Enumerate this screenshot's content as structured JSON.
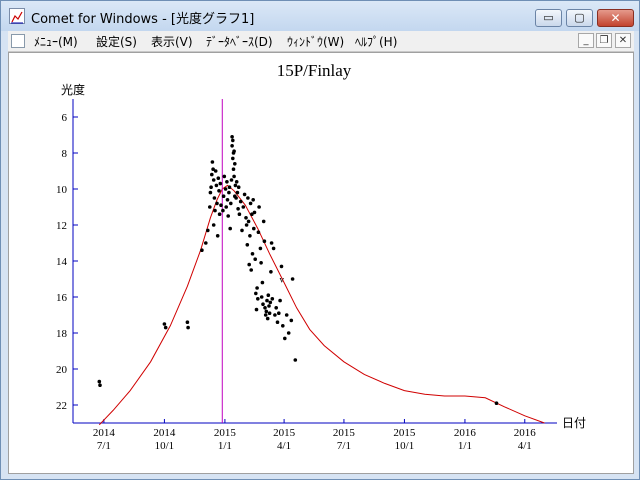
{
  "window": {
    "title": "Comet for Windows - [光度グラフ1]",
    "controls": {
      "minimize": "▭",
      "maximize": "▢",
      "close": "✕"
    }
  },
  "menu": {
    "items": [
      "ﾒﾆｭｰ(M)",
      "設定(S)",
      "表示(V)",
      "ﾃﾞｰﾀﾍﾞｰｽ(D)",
      "ｳｨﾝﾄﾞｳ(W)",
      "ﾍﾙﾌﾟ(H)"
    ],
    "mdi_controls": {
      "minimize": "_",
      "restore": "❐",
      "close": "✕"
    }
  },
  "chart_data": {
    "type": "scatter",
    "title": "15P/Finlay",
    "ylabel": "光度",
    "xlabel": "日付",
    "ylim": [
      5,
      23
    ],
    "y_inverted": true,
    "y_ticks": [
      6,
      8,
      10,
      12,
      14,
      16,
      18,
      20,
      22
    ],
    "xlim": [
      "2014-05-15",
      "2016-05-20"
    ],
    "x_ticks": [
      {
        "date": "2014-07-01",
        "year": "2014",
        "label": "7/1"
      },
      {
        "date": "2014-10-01",
        "year": "2014",
        "label": "10/1"
      },
      {
        "date": "2015-01-01",
        "year": "2015",
        "label": "1/1"
      },
      {
        "date": "2015-04-01",
        "year": "2015",
        "label": "4/1"
      },
      {
        "date": "2015-07-01",
        "year": "2015",
        "label": "7/1"
      },
      {
        "date": "2015-10-01",
        "year": "2015",
        "label": "10/1"
      },
      {
        "date": "2016-01-01",
        "year": "2016",
        "label": "1/1"
      },
      {
        "date": "2016-04-01",
        "year": "2016",
        "label": "4/1"
      }
    ],
    "marker_date": "2014-12-28",
    "annotation": {
      "date": "2015-03-25",
      "mag": 15.2,
      "text": "v"
    },
    "colors": {
      "axis": "#0000c0",
      "curve": "#d00000",
      "points": "#000000",
      "marker": "#c000c0"
    },
    "series": [
      {
        "points": [
          [
            "2014-06-24",
            20.7
          ],
          [
            "2014-06-25",
            20.9
          ],
          [
            "2014-10-01",
            17.5
          ],
          [
            "2014-10-03",
            17.7
          ],
          [
            "2014-11-05",
            17.4
          ],
          [
            "2014-11-06",
            17.7
          ],
          [
            "2014-11-27",
            13.4
          ],
          [
            "2014-12-03",
            13.0
          ],
          [
            "2014-12-06",
            12.3
          ],
          [
            "2014-12-09",
            11.0
          ],
          [
            "2014-12-10",
            10.2
          ],
          [
            "2014-12-11",
            9.9
          ],
          [
            "2014-12-12",
            9.2
          ],
          [
            "2014-12-13",
            8.5
          ],
          [
            "2014-12-14",
            8.9
          ],
          [
            "2014-12-15",
            9.5
          ],
          [
            "2014-12-15",
            12.0
          ],
          [
            "2014-12-16",
            10.5
          ],
          [
            "2014-12-17",
            11.2
          ],
          [
            "2014-12-18",
            9.0
          ],
          [
            "2014-12-19",
            9.8
          ],
          [
            "2014-12-20",
            10.8
          ],
          [
            "2014-12-21",
            12.6
          ],
          [
            "2014-12-22",
            9.4
          ],
          [
            "2014-12-23",
            10.1
          ],
          [
            "2014-12-24",
            11.4
          ],
          [
            "2014-12-25",
            9.7
          ],
          [
            "2014-12-26",
            10.9
          ],
          [
            "2014-12-29",
            11.2
          ],
          [
            "2014-12-30",
            10.4
          ],
          [
            "2014-12-31",
            9.3
          ],
          [
            "2015-01-02",
            10.0
          ],
          [
            "2015-01-03",
            11.0
          ],
          [
            "2015-01-04",
            9.6
          ],
          [
            "2015-01-05",
            10.6
          ],
          [
            "2015-01-06",
            11.5
          ],
          [
            "2015-01-07",
            10.2
          ],
          [
            "2015-01-08",
            9.9
          ],
          [
            "2015-01-09",
            12.2
          ],
          [
            "2015-01-10",
            10.8
          ],
          [
            "2015-01-11",
            9.5
          ],
          [
            "2015-01-12",
            7.1
          ],
          [
            "2015-01-12",
            7.6
          ],
          [
            "2015-01-13",
            7.3
          ],
          [
            "2015-01-13",
            8.3
          ],
          [
            "2015-01-14",
            8.0
          ],
          [
            "2015-01-14",
            8.9
          ],
          [
            "2015-01-15",
            7.9
          ],
          [
            "2015-01-15",
            9.3
          ],
          [
            "2015-01-16",
            8.6
          ],
          [
            "2015-01-16",
            10.4
          ],
          [
            "2015-01-17",
            9.8
          ],
          [
            "2015-01-18",
            10.5
          ],
          [
            "2015-01-19",
            9.6
          ],
          [
            "2015-01-20",
            10.2
          ],
          [
            "2015-01-21",
            11.1
          ],
          [
            "2015-01-22",
            9.9
          ],
          [
            "2015-01-23",
            11.4
          ],
          [
            "2015-01-25",
            10.7
          ],
          [
            "2015-01-27",
            12.3
          ],
          [
            "2015-01-29",
            11.0
          ],
          [
            "2015-01-31",
            10.3
          ],
          [
            "2015-02-02",
            11.6
          ],
          [
            "2015-02-03",
            12.0
          ],
          [
            "2015-02-04",
            13.1
          ],
          [
            "2015-02-05",
            10.5
          ],
          [
            "2015-02-06",
            11.8
          ],
          [
            "2015-02-07",
            14.2
          ],
          [
            "2015-02-08",
            12.6
          ],
          [
            "2015-02-09",
            10.8
          ],
          [
            "2015-02-10",
            14.5
          ],
          [
            "2015-02-11",
            11.4
          ],
          [
            "2015-02-12",
            13.6
          ],
          [
            "2015-02-13",
            10.6
          ],
          [
            "2015-02-14",
            12.2
          ],
          [
            "2015-02-15",
            11.3
          ],
          [
            "2015-02-16",
            13.9
          ],
          [
            "2015-02-17",
            15.8
          ],
          [
            "2015-02-18",
            16.7
          ],
          [
            "2015-02-19",
            15.5
          ],
          [
            "2015-02-20",
            16.1
          ],
          [
            "2015-02-21",
            12.4
          ],
          [
            "2015-02-22",
            11.0
          ],
          [
            "2015-02-24",
            13.3
          ],
          [
            "2015-02-25",
            14.1
          ],
          [
            "2015-02-26",
            16.0
          ],
          [
            "2015-02-27",
            15.2
          ],
          [
            "2015-02-28",
            16.4
          ],
          [
            "2015-03-01",
            11.8
          ],
          [
            "2015-03-02",
            12.9
          ],
          [
            "2015-03-03",
            16.6
          ],
          [
            "2015-03-04",
            17.0
          ],
          [
            "2015-03-05",
            16.8
          ],
          [
            "2015-03-06",
            16.2
          ],
          [
            "2015-03-07",
            17.2
          ],
          [
            "2015-03-08",
            15.9
          ],
          [
            "2015-03-09",
            16.5
          ],
          [
            "2015-03-10",
            16.9
          ],
          [
            "2015-03-11",
            16.3
          ],
          [
            "2015-03-12",
            14.6
          ],
          [
            "2015-03-13",
            13.0
          ],
          [
            "2015-03-14",
            16.1
          ],
          [
            "2015-03-16",
            13.3
          ],
          [
            "2015-03-18",
            17.0
          ],
          [
            "2015-03-20",
            16.6
          ],
          [
            "2015-03-22",
            17.4
          ],
          [
            "2015-03-24",
            16.9
          ],
          [
            "2015-03-26",
            16.2
          ],
          [
            "2015-03-28",
            14.3
          ],
          [
            "2015-03-30",
            17.6
          ],
          [
            "2015-04-02",
            18.3
          ],
          [
            "2015-04-05",
            17.0
          ],
          [
            "2015-04-08",
            18.0
          ],
          [
            "2015-04-12",
            17.3
          ],
          [
            "2015-04-14",
            15.0
          ],
          [
            "2015-04-18",
            19.5
          ],
          [
            "2016-02-18",
            21.9
          ]
        ]
      },
      {
        "curve": [
          [
            "2014-06-24",
            23.1
          ],
          [
            "2014-07-15",
            22.3
          ],
          [
            "2014-08-10",
            21.2
          ],
          [
            "2014-09-10",
            19.6
          ],
          [
            "2014-10-10",
            17.6
          ],
          [
            "2014-11-05",
            15.4
          ],
          [
            "2014-11-25",
            13.4
          ],
          [
            "2014-12-10",
            11.6
          ],
          [
            "2014-12-20",
            10.6
          ],
          [
            "2014-12-28",
            10.0
          ],
          [
            "2015-01-05",
            9.8
          ],
          [
            "2015-01-15",
            10.1
          ],
          [
            "2015-02-01",
            10.9
          ],
          [
            "2015-02-20",
            12.2
          ],
          [
            "2015-03-10",
            13.6
          ],
          [
            "2015-04-01",
            15.2
          ],
          [
            "2015-04-20",
            16.6
          ],
          [
            "2015-05-10",
            17.8
          ],
          [
            "2015-06-01",
            18.7
          ],
          [
            "2015-07-01",
            19.6
          ],
          [
            "2015-08-01",
            20.3
          ],
          [
            "2015-09-01",
            20.8
          ],
          [
            "2015-10-01",
            21.2
          ],
          [
            "2015-11-01",
            21.4
          ],
          [
            "2015-12-01",
            21.5
          ],
          [
            "2016-01-01",
            21.5
          ],
          [
            "2016-02-01",
            21.6
          ],
          [
            "2016-03-01",
            22.1
          ],
          [
            "2016-04-01",
            22.6
          ],
          [
            "2016-05-01",
            23.0
          ]
        ]
      }
    ]
  }
}
